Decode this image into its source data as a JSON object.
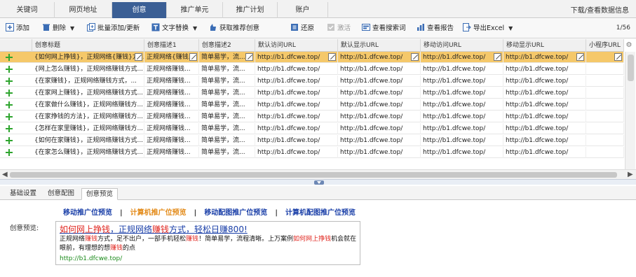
{
  "topbar": {
    "tabs": [
      "关键词",
      "网页地址",
      "创意",
      "推广单元",
      "推广计划",
      "账户"
    ],
    "right_link": "下载/查看数据信息"
  },
  "toolbar": {
    "add": "添加",
    "delete": "删除",
    "batch": "批量添加/更新",
    "replace": "文字替换",
    "get_recommend": "获取推荐创意",
    "restore": "还原",
    "activate": "激活",
    "search_terms": "查看搜索词",
    "report": "查看报告",
    "export": "导出Excel",
    "pager": "1/56"
  },
  "grid": {
    "columns": [
      "创意标题",
      "创意描述1",
      "创意描述2",
      "默认访问URL",
      "默认显示URL",
      "移动访问URL",
      "移动显示URL",
      "小程序URL"
    ],
    "rows": [
      [
        "{如何网上挣钱}，正规网络{赚钱}方...",
        "正规网络{赚钱...",
        "简单易学，流...",
        "http://b1.dfcwe.top/",
        "http://b1.dfcwe.top/",
        "http://b1.dfcwe.top/",
        "http://b1.dfcwe.top/",
        ""
      ],
      [
        "{网上怎么赚钱}，正规网络赚钱方式...",
        "正规网络赚钱...",
        "简单易学，流...",
        "http://b1.dfcwe.top/",
        "http://b1.dfcwe.top/",
        "http://b1.dfcwe.top/",
        "http://b1.dfcwe.top/",
        ""
      ],
      [
        "{在家赚钱}，正规网络赚钱方式，...",
        "正规网络赚钱...",
        "简单易学，流...",
        "http://b1.dfcwe.top/",
        "http://b1.dfcwe.top/",
        "http://b1.dfcwe.top/",
        "http://b1.dfcwe.top/",
        ""
      ],
      [
        "{在家网上赚钱}，正规网络赚钱方式...",
        "正规网络赚钱...",
        "简单易学，流...",
        "http://b1.dfcwe.top/",
        "http://b1.dfcwe.top/",
        "http://b1.dfcwe.top/",
        "http://b1.dfcwe.top/",
        ""
      ],
      [
        "{在家做什么赚钱}，正规网络赚钱方...",
        "正规网络赚钱...",
        "简单易学，流...",
        "http://b1.dfcwe.top/",
        "http://b1.dfcwe.top/",
        "http://b1.dfcwe.top/",
        "http://b1.dfcwe.top/",
        ""
      ],
      [
        "{在家挣钱的方法}，正规网络赚钱方...",
        "正规网络赚钱...",
        "简单易学，流...",
        "http://b1.dfcwe.top/",
        "http://b1.dfcwe.top/",
        "http://b1.dfcwe.top/",
        "http://b1.dfcwe.top/",
        ""
      ],
      [
        "{怎样在家里赚钱}，正规网络赚钱方...",
        "正规网络赚钱...",
        "简单易学，流...",
        "http://b1.dfcwe.top/",
        "http://b1.dfcwe.top/",
        "http://b1.dfcwe.top/",
        "http://b1.dfcwe.top/",
        ""
      ],
      [
        "{如何在家赚钱}，正规网络赚钱方式...",
        "正规网络赚钱...",
        "简单易学，流...",
        "http://b1.dfcwe.top/",
        "http://b1.dfcwe.top/",
        "http://b1.dfcwe.top/",
        "http://b1.dfcwe.top/",
        ""
      ],
      [
        "{在家怎么赚钱}，正规网络赚钱方式...",
        "正规网络赚钱...",
        "简单易学，流...",
        "http://b1.dfcwe.top/",
        "http://b1.dfcwe.top/",
        "http://b1.dfcwe.top/",
        "http://b1.dfcwe.top/",
        ""
      ]
    ]
  },
  "bottom_tabs": [
    "基础设置",
    "创意配图",
    "创意预览"
  ],
  "preview": {
    "links": [
      "移动推广位预览",
      "计算机推广位预览",
      "移动配图推广位预览",
      "计算机配图推广位预览"
    ],
    "separator": "|",
    "label": "创意预览:",
    "title_red": "如何网上挣钱",
    "title_mid": "，正规网络",
    "title_red2": "赚钱",
    "title_end": "方式，轻松日赚800!",
    "desc_1": "正规网络",
    "desc_red1": "赚钱",
    "desc_2": "方式，足不出户，一部手机轻松",
    "desc_red2": "赚钱",
    "desc_3": "！简单易学，流程清晰。上万案例",
    "desc_red3": "如何网上挣钱",
    "desc_4": "机会就在眼前，有理想的想",
    "desc_red4": "赚钱",
    "desc_5": "的点",
    "url": "http://b1.dfcwe.top/"
  },
  "colors": {
    "active_tab": "#3b5f95",
    "selected_row": "#f5c86a",
    "link_blue": "#1a3fa8",
    "highlight_red": "#e0261f",
    "url_green": "#1a8a1a"
  }
}
